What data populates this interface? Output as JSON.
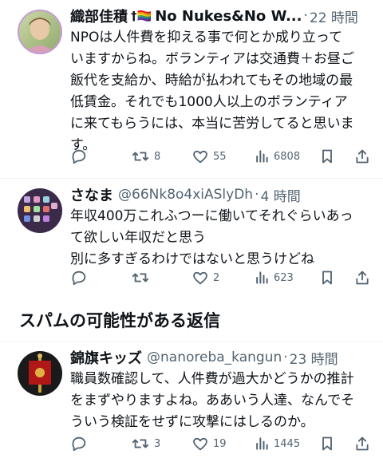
{
  "tweets": [
    {
      "name": "織部佳積",
      "name_badge": "†🏳️‍🌈",
      "name_rest": "No Nukes&No W...",
      "handle": "",
      "sep": "·",
      "time": "22 時間",
      "text": "NPOは人件費を抑える事で何とか成り立って\nいますからね。ボランティアは交通費＋お昼ご\n飯代を支給か、時給が払われてもその地域の最\n低賃金。それでも1000人以上のボランティア\nに来てもらうには、本当に苦労してると思いま\nす。",
      "reply_count": "",
      "retweet_count": "8",
      "like_count": "55",
      "view_count": "6808"
    },
    {
      "name": "さなま",
      "handle": "@66Nk8o4xiASlyDh",
      "sep": "·",
      "time": "4 時間",
      "text": "年収400万これふつーに働いてそれぐらいあっ\nて欲しい年収だと思う\n別に多すぎるわけではないと思うけどね",
      "reply_count": "",
      "retweet_count": "",
      "like_count": "2",
      "view_count": "623"
    },
    {
      "name": "錦旗キッズ",
      "handle": "@nanoreba_kangun",
      "sep": "·",
      "time": "23 時間",
      "text": "職員数確認して、人件費が過大かどうかの推計\nをまずやりますよね。ああいう人達、なんでそ\nういう検証をせずに攻撃にはしるのか。",
      "reply_count": "",
      "retweet_count": "3",
      "like_count": "19",
      "view_count": "1445"
    }
  ],
  "section": {
    "spam_title": "スパムの可能性がある返信"
  },
  "colors": {
    "text": "#0f1419",
    "muted": "#536471",
    "divider": "#eff3f4"
  },
  "icons": [
    "reply-icon",
    "retweet-icon",
    "like-icon",
    "views-icon",
    "bookmark-icon",
    "share-icon"
  ]
}
